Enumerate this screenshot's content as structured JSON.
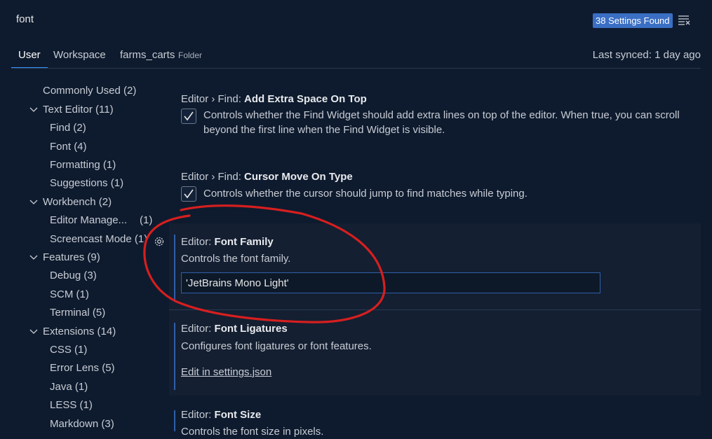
{
  "search": {
    "query": "font",
    "results_badge": "38 Settings Found"
  },
  "tabs": {
    "user": "User",
    "workspace": "Workspace",
    "folder": "farms_carts",
    "folder_hint": "Folder"
  },
  "sync_status": "Last synced: 1 day ago",
  "toc": [
    {
      "label": "Commonly Used",
      "count": "(2)"
    },
    {
      "label": "Text Editor",
      "count": "(11)"
    },
    {
      "label": "Find",
      "count": "(2)"
    },
    {
      "label": "Font",
      "count": "(4)"
    },
    {
      "label": "Formatting",
      "count": "(1)"
    },
    {
      "label": "Suggestions",
      "count": "(1)"
    },
    {
      "label": "Workbench",
      "count": "(2)"
    },
    {
      "label": "Editor Manage...",
      "count": "(1)"
    },
    {
      "label": "Screencast Mode",
      "count": "(1)"
    },
    {
      "label": "Features",
      "count": "(9)"
    },
    {
      "label": "Debug",
      "count": "(3)"
    },
    {
      "label": "SCM",
      "count": "(1)"
    },
    {
      "label": "Terminal",
      "count": "(5)"
    },
    {
      "label": "Extensions",
      "count": "(14)"
    },
    {
      "label": "CSS",
      "count": "(1)"
    },
    {
      "label": "Error Lens",
      "count": "(5)"
    },
    {
      "label": "Java",
      "count": "(1)"
    },
    {
      "label": "LESS",
      "count": "(1)"
    },
    {
      "label": "Markdown",
      "count": "(3)"
    }
  ],
  "settings": [
    {
      "category": "Editor › Find: ",
      "name": "Add Extra Space On Top",
      "description": "Controls whether the Find Widget should add extra lines on top of the editor. When true, you can scroll beyond the first line when the Find Widget is visible.",
      "checked": true
    },
    {
      "category": "Editor › Find: ",
      "name": "Cursor Move On Type",
      "description": "Controls whether the cursor should jump to find matches while typing.",
      "checked": true
    },
    {
      "category": "Editor: ",
      "name": "Font Family",
      "description": "Controls the font family.",
      "value": "'JetBrains Mono Light'"
    },
    {
      "category": "Editor: ",
      "name": "Font Ligatures",
      "description": "Configures font ligatures or font features.",
      "link": "Edit in settings.json"
    },
    {
      "category": "Editor: ",
      "name": "Font Size",
      "description": "Controls the font size in pixels."
    }
  ],
  "colors": {
    "accent": "#3794ff",
    "badge": "#3a6fc4",
    "annotation": "#d61f1f"
  },
  "icons": [
    "clear-filter-icon",
    "gear-icon",
    "chevron-down-icon",
    "checkmark-icon"
  ]
}
